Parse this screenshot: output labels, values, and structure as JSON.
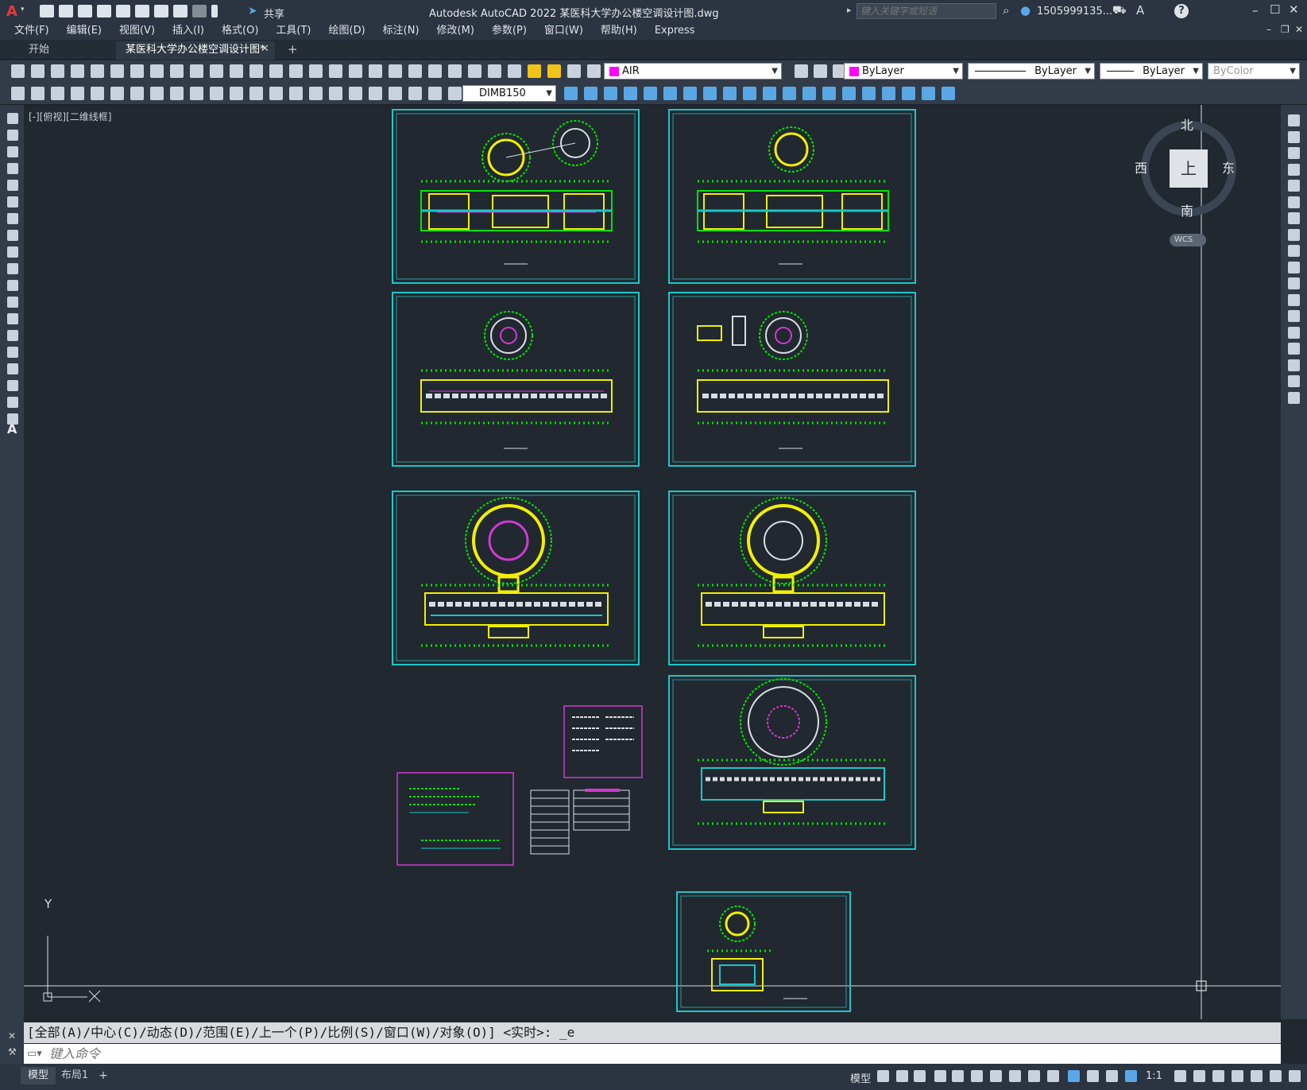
{
  "app": {
    "title": "Autodesk AutoCAD 2022    某医科大学办公楼空调设计图.dwg",
    "logo_letter": "A",
    "share_label": "共享",
    "search_placeholder": "键入关键字或短语",
    "user_name": "1505999135...",
    "help_label": "?"
  },
  "menus": [
    "文件(F)",
    "编辑(E)",
    "视图(V)",
    "插入(I)",
    "格式(O)",
    "工具(T)",
    "绘图(D)",
    "标注(N)",
    "修改(M)",
    "参数(P)",
    "窗口(W)",
    "帮助(H)",
    "Express"
  ],
  "tabs": [
    {
      "label": "开始"
    },
    {
      "label": "某医科大学办公楼空调设计图*"
    }
  ],
  "tab_add": "+",
  "toolbar": {
    "layer": "AIR",
    "color": "ByLayer",
    "color_swatch": "#ff00ff",
    "linetype": "ByLayer",
    "lineweight": "ByLayer",
    "plotstyle": "ByColor",
    "dimstyle": "DIMB150"
  },
  "viewport_label": "[-][俯视][二维线框]",
  "viewcube": {
    "north": "北",
    "south": "南",
    "east": "东",
    "west": "西",
    "face": "上",
    "wcs": "WCS"
  },
  "ucs": {
    "x": "X",
    "y": "Y"
  },
  "command": {
    "history": "[全部(A)/中心(C)/动态(D)/范围(E)/上一个(P)/比例(S)/窗口(W)/对象(O)] <实时>: _e",
    "placeholder": "键入命令"
  },
  "layout_tabs": [
    "模型",
    "布局1",
    "+"
  ],
  "status": {
    "model": "模型",
    "scale": "1:1"
  },
  "colors": {
    "sheet_frame": "#1cc6c8",
    "green": "#00e400",
    "yellow": "#f0f000",
    "magenta": "#d03ad0"
  }
}
